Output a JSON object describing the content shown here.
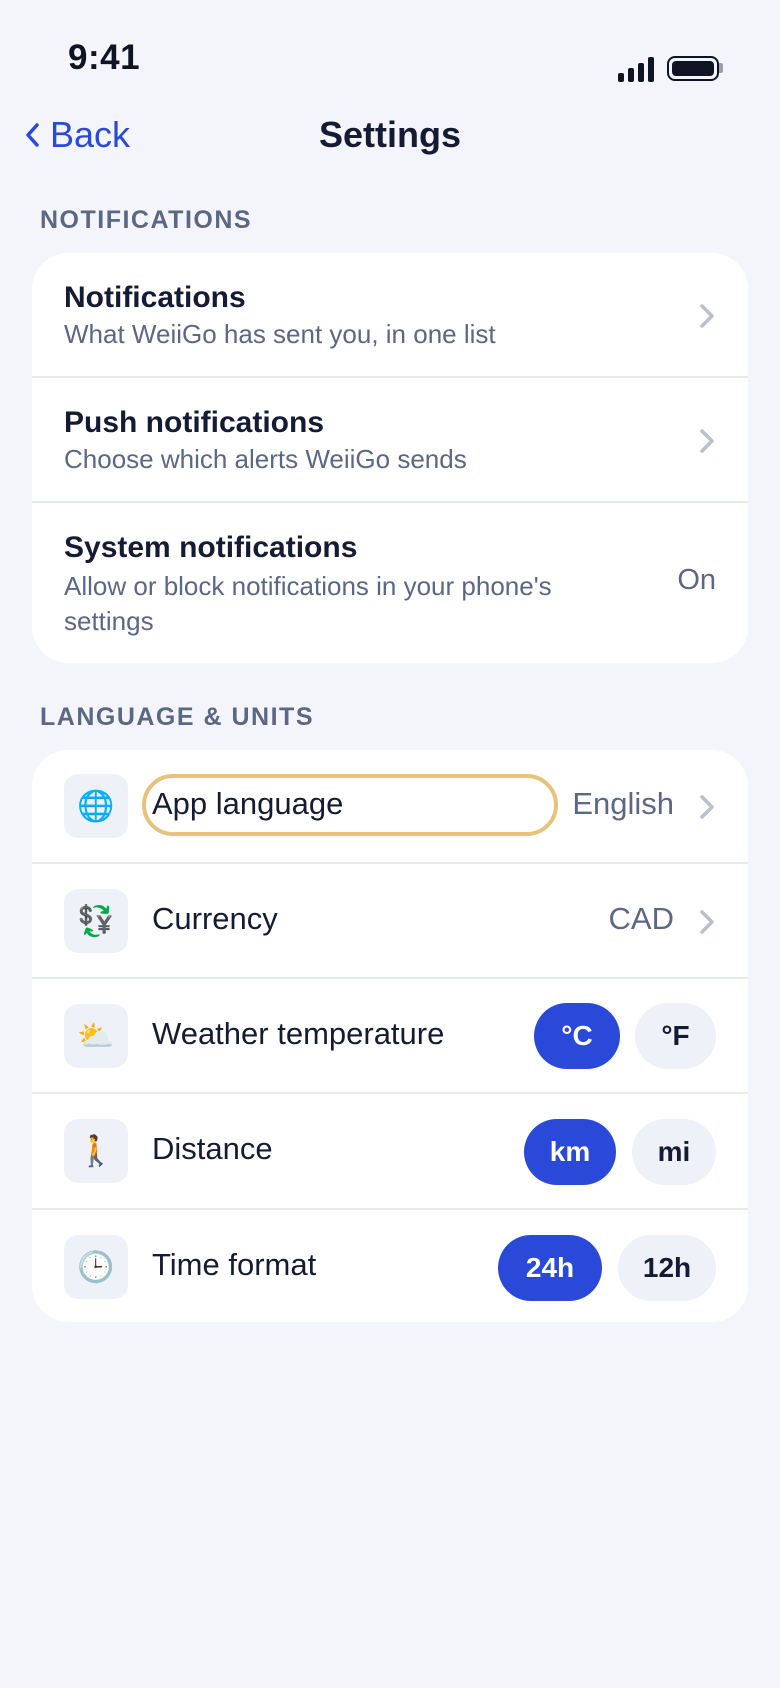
{
  "status_bar": {
    "time": "9:41"
  },
  "nav": {
    "back_label": "Back",
    "title": "Settings"
  },
  "notifications_section": {
    "header": "NOTIFICATIONS",
    "rows": [
      {
        "title": "Notifications",
        "subtitle": "What WeiiGo has sent you, in one list"
      },
      {
        "title": "Push notifications",
        "subtitle": "Choose which alerts WeiiGo sends"
      },
      {
        "title": "System notifications",
        "subtitle_line1": "Allow or block notifications in your phone's",
        "subtitle_line2": "settings",
        "value": "On"
      }
    ]
  },
  "language_units_section": {
    "header": "LANGUAGE & UNITS",
    "app_language": {
      "icon": "globe-icon",
      "glyph": "🌐",
      "label": "App language",
      "value": "English"
    },
    "currency": {
      "icon": "currency-exchange-icon",
      "glyph": "💱",
      "label": "Currency",
      "value": "CAD"
    },
    "weather": {
      "icon": "sun-behind-cloud-icon",
      "glyph": "⛅",
      "label": "Weather temperature",
      "options": [
        "°C",
        "°F"
      ],
      "selected": "°C"
    },
    "distance": {
      "icon": "walking-person-icon",
      "glyph": "🚶",
      "label": "Distance",
      "options": [
        "km",
        "mi"
      ],
      "selected": "km"
    },
    "time_format": {
      "icon": "clock-icon",
      "glyph": "🕒",
      "label": "Time format",
      "options": [
        "24h",
        "12h"
      ],
      "selected": "24h"
    }
  },
  "colors": {
    "accent": "#2a49d8",
    "focus": "#e6c27a",
    "background": "#f3f5fa",
    "muted_text": "#5b6784"
  }
}
